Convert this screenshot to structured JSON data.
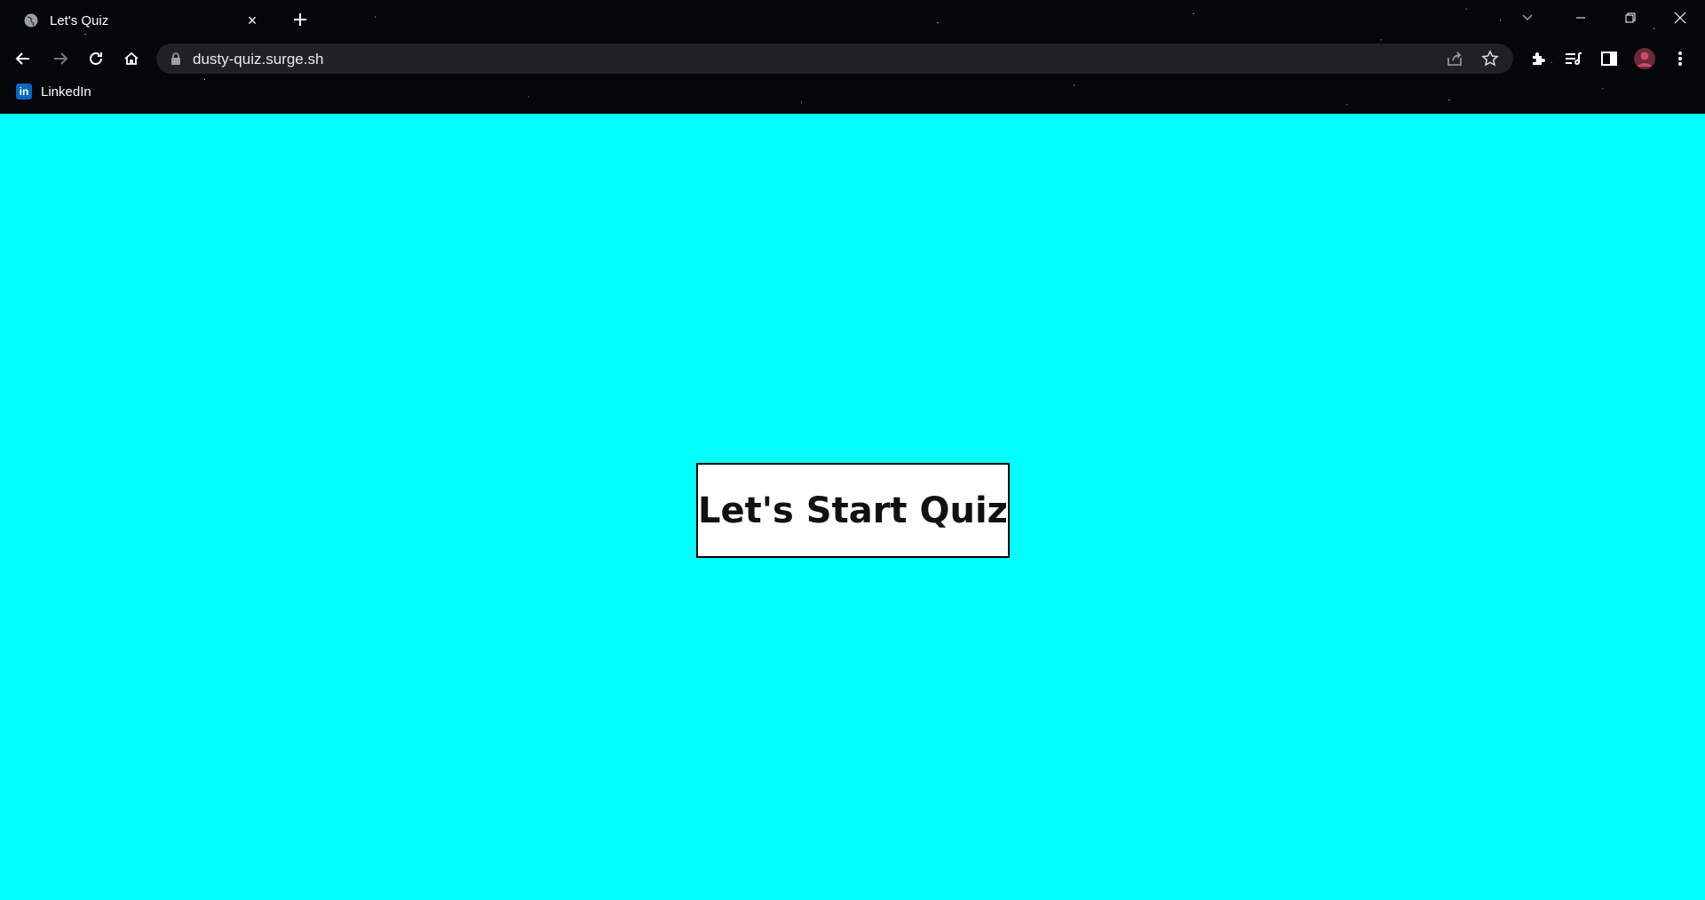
{
  "browser": {
    "tab": {
      "title": "Let's Quiz",
      "favicon": "globe-icon",
      "close": "×"
    },
    "new_tab": "+",
    "address_bar": {
      "url": "dusty-quiz.surge.sh",
      "secure_icon": "lock-icon"
    },
    "bookmarks": [
      {
        "label": "LinkedIn",
        "icon": "in"
      }
    ],
    "colors": {
      "frame": "#05060a",
      "omnibox": "#202124",
      "linkedin": "#0a66c2"
    }
  },
  "page": {
    "background": "#00ffff",
    "start_button_label": "Let's Start Quiz"
  }
}
